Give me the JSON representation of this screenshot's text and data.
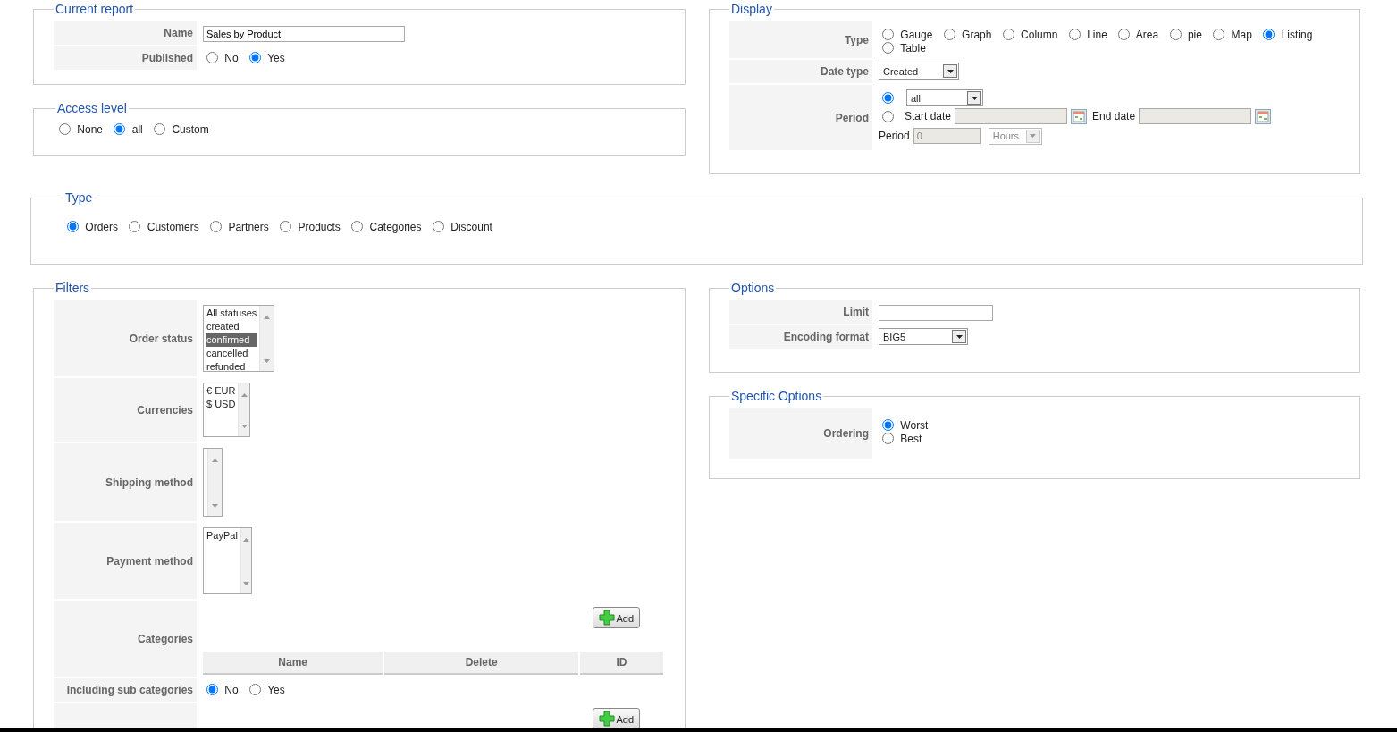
{
  "current_report": {
    "legend": "Current report",
    "rows": [
      {
        "label": "Name",
        "kind": "text",
        "value": "Sales by Product"
      },
      {
        "label": "Published",
        "kind": "radio",
        "options": [
          {
            "label": "No",
            "selected": false
          },
          {
            "label": "Yes",
            "selected": true
          }
        ]
      }
    ]
  },
  "access_level": {
    "legend": "Access level",
    "options": [
      {
        "label": "None",
        "selected": false
      },
      {
        "label": "all",
        "selected": true
      },
      {
        "label": "Custom",
        "selected": false
      }
    ]
  },
  "display": {
    "legend": "Display",
    "rows": [
      {
        "label": "Type",
        "kind": "radio",
        "options": [
          {
            "label": "Gauge",
            "selected": false
          },
          {
            "label": "Graph",
            "selected": false
          },
          {
            "label": "Column",
            "selected": false
          },
          {
            "label": "Line",
            "selected": false
          },
          {
            "label": "Area",
            "selected": false
          },
          {
            "label": "pie",
            "selected": false
          },
          {
            "label": "Map",
            "selected": false
          },
          {
            "label": "Listing",
            "selected": true
          },
          {
            "label": "Table",
            "selected": false
          }
        ]
      },
      {
        "label": "Date type",
        "kind": "select",
        "value": "Created",
        "disabled": false
      },
      {
        "label": "Period",
        "kind": "period",
        "choices": [
          {
            "kind": "preset",
            "selected": true,
            "value": "all"
          },
          {
            "kind": "range",
            "selected": false,
            "start_label": "Start date",
            "end_label": "End date",
            "disabled": true
          }
        ],
        "count": {
          "label": "Period",
          "value": "0",
          "unit": "Hours",
          "disabled": true
        }
      }
    ]
  },
  "type": {
    "legend": "Type",
    "options": [
      {
        "label": "Orders",
        "selected": true
      },
      {
        "label": "Customers",
        "selected": false
      },
      {
        "label": "Partners",
        "selected": false
      },
      {
        "label": "Products",
        "selected": false
      },
      {
        "label": "Categories",
        "selected": false
      },
      {
        "label": "Discount",
        "selected": false
      }
    ]
  },
  "filters": {
    "legend": "Filters",
    "rows": [
      {
        "label": "Order status",
        "kind": "listbox",
        "items": [
          {
            "text": "All statuses",
            "selected": false
          },
          {
            "text": "created",
            "selected": false
          },
          {
            "text": "confirmed",
            "selected": true
          },
          {
            "text": "cancelled",
            "selected": false
          },
          {
            "text": "refunded",
            "selected": false
          }
        ]
      },
      {
        "label": "Currencies",
        "kind": "listbox",
        "items": [
          {
            "text": "€ EUR",
            "selected": false
          },
          {
            "text": "$ USD",
            "selected": false
          }
        ]
      },
      {
        "label": "Shipping method",
        "kind": "listbox"
      },
      {
        "label": "Payment method",
        "kind": "listbox",
        "items": [
          {
            "text": "PayPal",
            "selected": false
          }
        ]
      },
      {
        "label": "Categories",
        "kind": "table",
        "button": "Add",
        "columns": [
          "Name",
          "Delete",
          "ID"
        ]
      },
      {
        "label": "Including sub categories",
        "kind": "radio",
        "options": [
          {
            "label": "No",
            "selected": true
          },
          {
            "label": "Yes",
            "selected": false
          }
        ]
      },
      {
        "kind": "button",
        "button": "Add"
      }
    ]
  },
  "options": {
    "legend": "Options",
    "rows": [
      {
        "label": "Limit",
        "kind": "text"
      },
      {
        "label": "Encoding format",
        "kind": "select",
        "value": "BIG5",
        "disabled": false
      }
    ]
  },
  "specific_options": {
    "legend": "Specific Options",
    "rows": [
      {
        "label": "Ordering",
        "kind": "radio",
        "options": [
          {
            "label": "Worst",
            "selected": true
          },
          {
            "label": "Best",
            "selected": false
          }
        ]
      }
    ]
  }
}
